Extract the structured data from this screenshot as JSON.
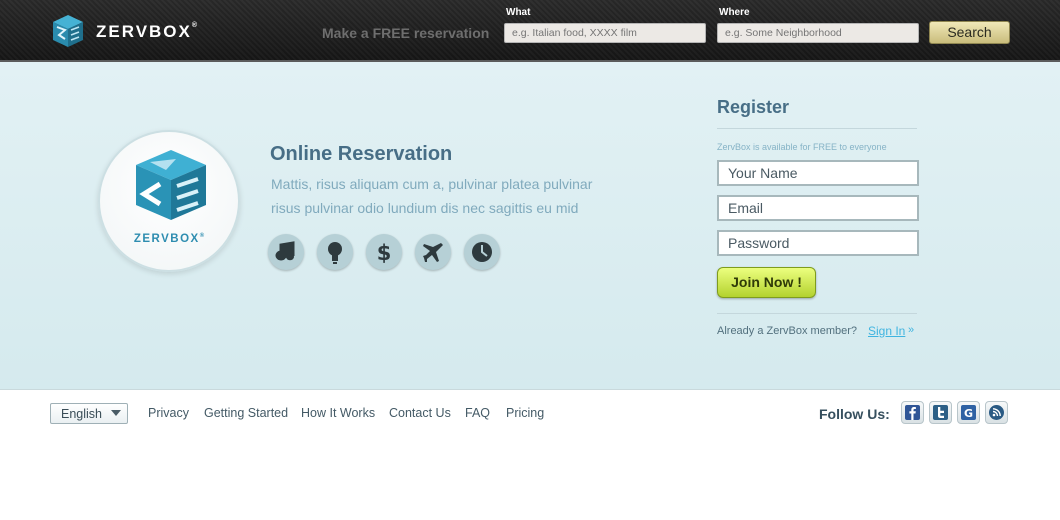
{
  "header": {
    "brand": "ZERVBOX",
    "brand_mark": "®",
    "tagline": "Make a FREE reservation",
    "what_label": "What",
    "what_placeholder": "e.g. Italian food, XXXX film",
    "where_label": "Where",
    "where_placeholder": "e.g. Some Neighborhood",
    "search_label": "Search"
  },
  "hero": {
    "logo_brand": "ZERVBOX",
    "logo_mark": "®",
    "title": "Online Reservation",
    "description_line1": "Mattis, risus aliquam cum a, pulvinar platea pulvinar",
    "description_line2": "risus pulvinar odio lundium dis nec sagittis eu mid",
    "features": [
      "music-note-icon",
      "lightbulb-icon",
      "dollar-icon",
      "airplane-icon",
      "clock-icon"
    ]
  },
  "register": {
    "title": "Register",
    "subtitle": "ZervBox is available for FREE to everyone",
    "name_value": "Your Name",
    "email_value": "Email",
    "password_value": "Password",
    "join_label": "Join Now !",
    "member_text": "Already a ZervBox member?",
    "signin_label": "Sign In",
    "signin_arrow": "»"
  },
  "footer": {
    "language": "English",
    "links": [
      "Privacy",
      "Getting Started",
      "How It Works",
      "Contact Us",
      "FAQ",
      "Pricing"
    ],
    "follow_label": "Follow Us:",
    "social": [
      "facebook-icon",
      "twitter-icon",
      "google-icon",
      "rss-icon"
    ]
  },
  "colors": {
    "header_bg": "#1c1c1c",
    "hero_bg": "#dcedf1",
    "accent_teal": "#2e8db0",
    "join_green": "#c8e23c",
    "search_gold": "#d9cd8c",
    "link_blue": "#3fb4e0"
  }
}
